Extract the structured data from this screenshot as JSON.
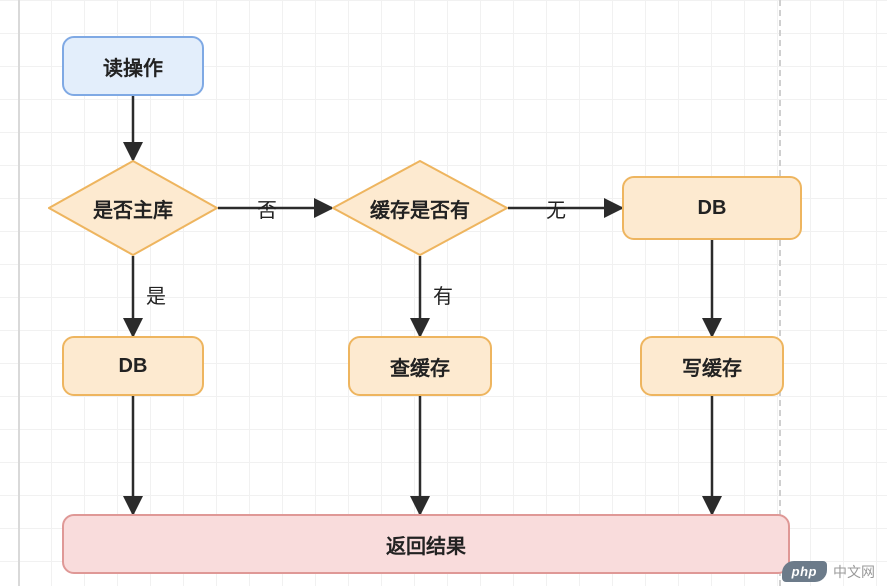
{
  "nodes": {
    "start": {
      "label": "读操作"
    },
    "is_master": {
      "label": "是否主库"
    },
    "cache_hit": {
      "label": "缓存是否有"
    },
    "db_right": {
      "label": "DB"
    },
    "db_left": {
      "label": "DB"
    },
    "read_cache": {
      "label": "查缓存"
    },
    "write_cache": {
      "label": "写缓存"
    },
    "return": {
      "label": "返回结果"
    }
  },
  "edge_labels": {
    "no": "否",
    "none": "无",
    "yes": "是",
    "has": "有"
  },
  "watermark": {
    "brand": "php",
    "text": "中文网"
  },
  "chart_data": {
    "type": "flowchart",
    "nodes": [
      {
        "id": "start",
        "kind": "terminator",
        "label": "读操作"
      },
      {
        "id": "is_master",
        "kind": "decision",
        "label": "是否主库"
      },
      {
        "id": "cache_hit",
        "kind": "decision",
        "label": "缓存是否有"
      },
      {
        "id": "db_right",
        "kind": "process",
        "label": "DB"
      },
      {
        "id": "db_left",
        "kind": "process",
        "label": "DB"
      },
      {
        "id": "read_cache",
        "kind": "process",
        "label": "查缓存"
      },
      {
        "id": "write_cache",
        "kind": "process",
        "label": "写缓存"
      },
      {
        "id": "return",
        "kind": "terminator",
        "label": "返回结果"
      }
    ],
    "edges": [
      {
        "from": "start",
        "to": "is_master",
        "label": ""
      },
      {
        "from": "is_master",
        "to": "cache_hit",
        "label": "否"
      },
      {
        "from": "is_master",
        "to": "db_left",
        "label": "是"
      },
      {
        "from": "cache_hit",
        "to": "db_right",
        "label": "无"
      },
      {
        "from": "cache_hit",
        "to": "read_cache",
        "label": "有"
      },
      {
        "from": "db_right",
        "to": "write_cache",
        "label": ""
      },
      {
        "from": "db_left",
        "to": "return",
        "label": ""
      },
      {
        "from": "read_cache",
        "to": "return",
        "label": ""
      },
      {
        "from": "write_cache",
        "to": "return",
        "label": ""
      }
    ]
  }
}
